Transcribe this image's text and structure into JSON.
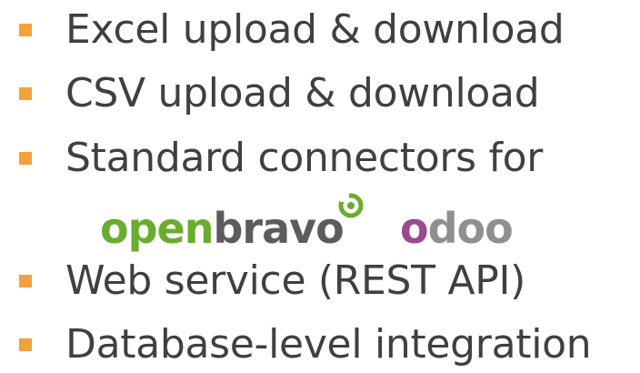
{
  "slide": {
    "bullets": [
      {
        "text": "Excel upload & download"
      },
      {
        "text": "CSV upload & download"
      },
      {
        "text": "Standard connectors for"
      },
      {
        "text": "Web service (REST API)"
      },
      {
        "text": "Database-level integration"
      }
    ],
    "logos": {
      "openbravo": {
        "part1": "open",
        "part2": "bravo"
      },
      "odoo": {
        "part1": "o",
        "part2": "doo"
      }
    }
  },
  "colors": {
    "bullet": "#f5a13a",
    "text": "#404040",
    "openbravo_green": "#6aac2e",
    "openbravo_gray": "#5c5c5c",
    "odoo_purple": "#9b4a8c",
    "odoo_gray": "#8f8f8f"
  }
}
